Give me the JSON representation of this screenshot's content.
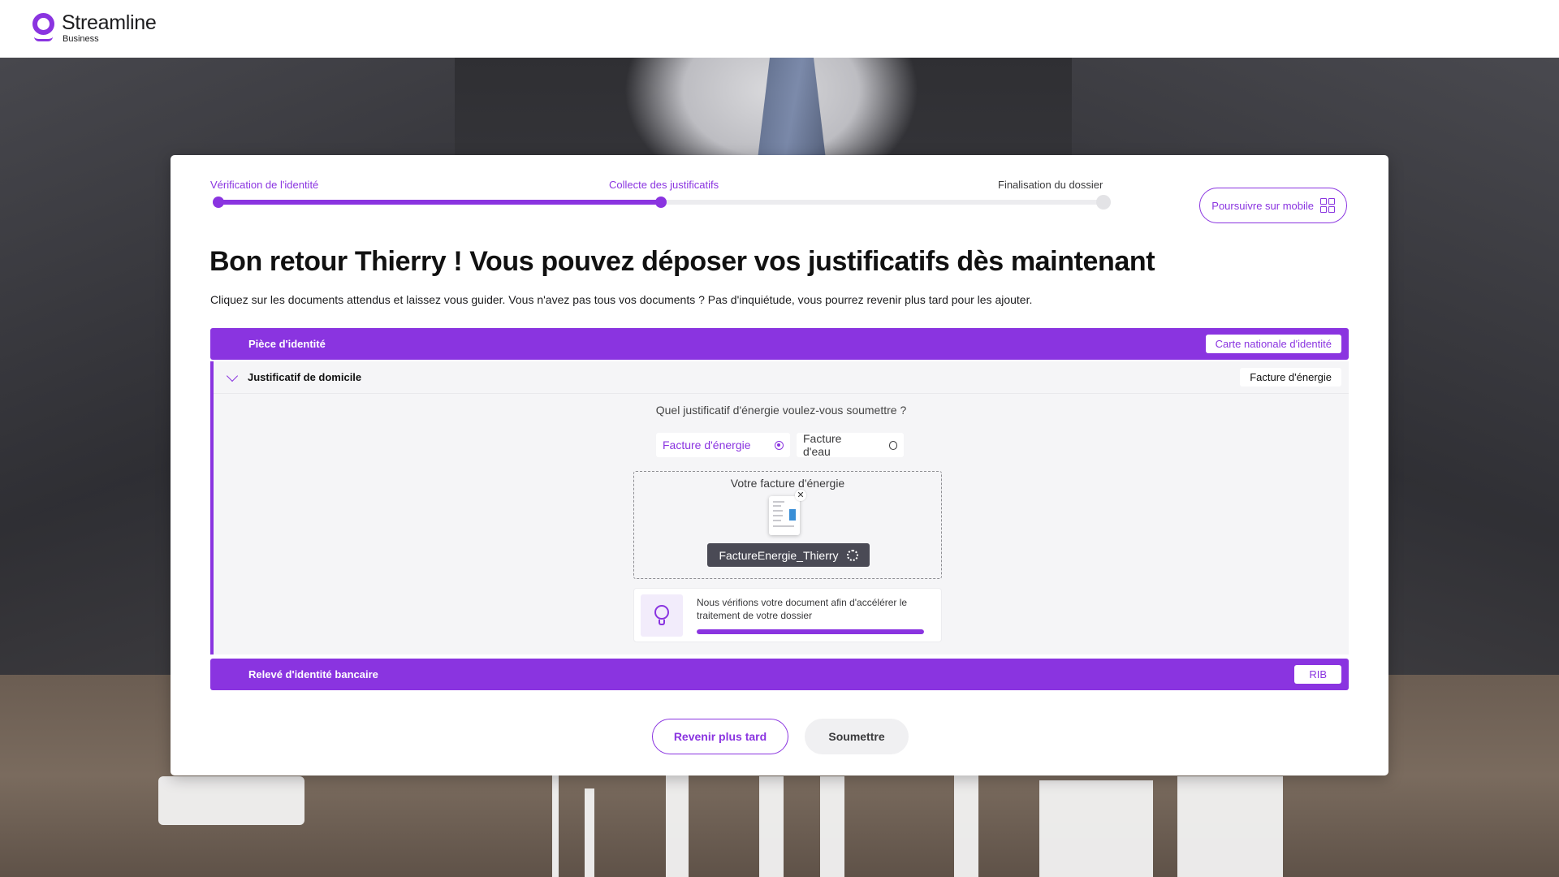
{
  "brand": {
    "name": "Streamline",
    "sub": "Business",
    "accent": "#8a34e0"
  },
  "stepper": {
    "steps": [
      {
        "label": "Vérification de l'identité",
        "state": "done"
      },
      {
        "label": "Collecte des justificatifs",
        "state": "current"
      },
      {
        "label": "Finalisation du dossier",
        "state": "todo"
      }
    ],
    "progress": 0.5
  },
  "mobile_button": {
    "label": "Poursuivre sur mobile",
    "icon": "qr-code-icon"
  },
  "heading": "Bon retour Thierry ! Vous pouvez déposer vos justificatifs dès maintenant",
  "intro": "Cliquez sur les documents attendus et laissez vous guider. Vous n'avez pas tous vos documents ? Pas d'inquiétude, vous pourrez revenir plus tard pour les ajouter.",
  "sections": {
    "identity": {
      "label": "Pièce d'identité",
      "value": "Carte nationale d'identité"
    },
    "address": {
      "label": "Justificatif de domicile",
      "value": "Facture d'énergie",
      "icon": "chevron-down-icon",
      "question": "Quel justificatif d'énergie voulez-vous soumettre ?",
      "options": [
        {
          "label": "Facture d'énergie",
          "checked": true
        },
        {
          "label": "Facture d'eau",
          "checked": false
        }
      ],
      "dropzone_label": "Votre facture d'énergie",
      "file_name": "FactureEnergie_Thierry",
      "file_icon": "document-thumbnail-icon",
      "tip_icon": "lightbulb-icon",
      "tip_text": "Nous vérifions votre document afin d'accélérer le traitement de votre dossier",
      "tip_progress": 1.0
    },
    "bank": {
      "label": "Relevé d'identité bancaire",
      "value": "RIB"
    }
  },
  "actions": {
    "later": "Revenir plus tard",
    "submit": "Soumettre"
  }
}
